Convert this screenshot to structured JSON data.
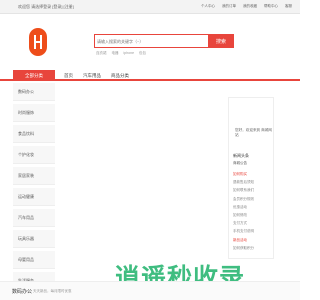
{
  "topbar": {
    "welcome": "欢迎您 请选择登录 [登录] [注册]",
    "links": [
      "个人中心",
      "我的订单",
      "我的收藏",
      "帮助中心",
      "客服"
    ]
  },
  "search": {
    "placeholder": "请输入搜索的关键字（~）",
    "button": "搜索",
    "hot_words": [
      "连衣裙",
      "电器",
      "iphone",
      "包包"
    ]
  },
  "nav": {
    "category_title": "全部分类",
    "links": [
      "首页",
      "汽车用品",
      "商品分类"
    ]
  },
  "sidebar": {
    "items": [
      "数码办公",
      "时尚服饰",
      "食品饮料",
      "个护化妆",
      "家居家装",
      "运动健康",
      "汽车用品",
      "玩具乐器",
      "母婴用品",
      "生活服务"
    ]
  },
  "right_panel": {
    "text": "您好，欢迎来到 商城网站",
    "heading": "新闻头条",
    "subheading": "商城公告",
    "list": [
      "如何购买",
      "退款售后须知",
      "如何联系我们",
      "会员积分规则",
      "优惠活动",
      "如何修改",
      "支付方式",
      "手机支付说明",
      "新品活动",
      "如何获取积分"
    ]
  },
  "footer": {
    "label": "数码办公",
    "tag": "天天新品，每月限时优惠"
  },
  "watermark": "逍遥秒收录"
}
